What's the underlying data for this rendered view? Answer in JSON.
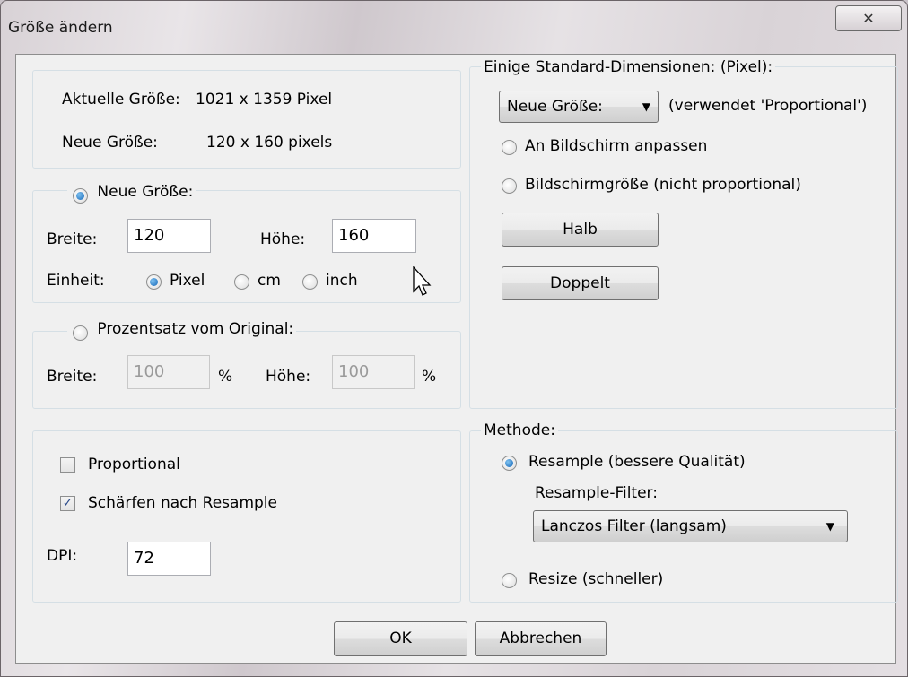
{
  "window": {
    "title": "Größe ändern",
    "close_glyph": "✕"
  },
  "info": {
    "current_label": "Aktuelle Größe:",
    "current_value": "1021  x  1359  Pixel",
    "new_label": "Neue Größe:",
    "new_value": "120  x  160  pixels"
  },
  "new_size": {
    "legend": "Neue Größe:",
    "width_label": "Breite:",
    "width_value": "120",
    "height_label": "Höhe:",
    "height_value": "160",
    "unit_label": "Einheit:",
    "units": [
      "Pixel",
      "cm",
      "inch"
    ]
  },
  "percent": {
    "legend": "Prozentsatz vom Original:",
    "width_label": "Breite:",
    "width_value": "100",
    "height_label": "Höhe:",
    "height_value": "100",
    "percent_sign": "%"
  },
  "options": {
    "proportional_label": "Proportional",
    "sharpen_label": "Schärfen nach Resample",
    "sharpen_check": "✓",
    "dpi_label": "DPI:",
    "dpi_value": "72"
  },
  "standard": {
    "legend": "Einige Standard-Dimensionen: (Pixel):",
    "select_value": "Neue Größe:",
    "select_note": "(verwendet 'Proportional')",
    "fit_screen": "An Bildschirm anpassen",
    "screen_size": "Bildschirmgröße (nicht proportional)",
    "half_button": "Halb",
    "double_button": "Doppelt"
  },
  "method": {
    "legend": "Methode:",
    "resample_label": "Resample (bessere Qualität)",
    "filter_label": "Resample-Filter:",
    "filter_value": "Lanczos Filter (langsam)",
    "resize_label": "Resize (schneller)"
  },
  "footer": {
    "ok_label": "OK",
    "cancel_label": "Abbrechen"
  },
  "icons": {
    "dropdown": "▼"
  },
  "colors": {
    "radio_selected": "#1466b8",
    "checkbox_check": "#2a4a8a"
  }
}
